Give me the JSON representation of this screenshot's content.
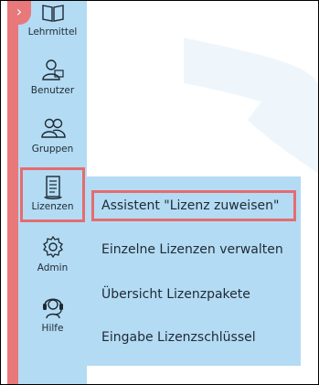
{
  "sidebar": {
    "items": [
      {
        "label": "Lehrmittel",
        "icon": "book-icon"
      },
      {
        "label": "Benutzer",
        "icon": "user-icon"
      },
      {
        "label": "Gruppen",
        "icon": "group-icon"
      },
      {
        "label": "Lizenzen",
        "icon": "license-scroll-icon",
        "active": true
      },
      {
        "label": "Admin",
        "icon": "gear-icon"
      },
      {
        "label": "Hilfe",
        "icon": "headset-icon"
      }
    ]
  },
  "submenu": {
    "items": [
      {
        "label": "Assistent \"Lizenz zuweisen\"",
        "highlighted": true
      },
      {
        "label": "Einzelne Lizenzen verwalten"
      },
      {
        "label": "Übersicht Lizenzpakete"
      },
      {
        "label": "Eingabe Lizenzschlüssel"
      }
    ]
  },
  "colors": {
    "sidebar_bg": "#b4dbf4",
    "accent_red": "#e8787a",
    "highlight_border": "#e56c6f"
  },
  "collapse_toggle": {
    "glyph": "›"
  }
}
